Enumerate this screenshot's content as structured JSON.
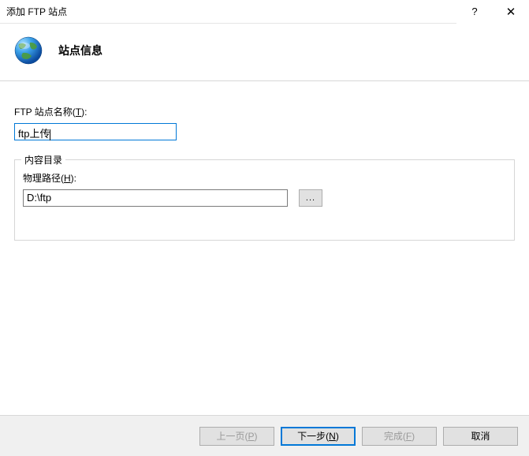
{
  "window": {
    "title": "添加 FTP 站点",
    "help": "?",
    "close": "✕"
  },
  "header": {
    "title": "站点信息"
  },
  "form": {
    "site_name": {
      "label_main": "FTP 站点名称(",
      "label_key": "T",
      "label_end": "):",
      "value": "ftp上传"
    },
    "content_dir": {
      "group_title": "内容目录",
      "path_label_main": "物理路径(",
      "path_label_key": "H",
      "path_label_end": "):",
      "path_value": "D:\\ftp",
      "browse_label": "..."
    }
  },
  "footer": {
    "prev_main": "上一页(",
    "prev_key": "P",
    "prev_end": ")",
    "next_main": "下一步(",
    "next_key": "N",
    "next_end": ")",
    "finish_main": "完成(",
    "finish_key": "F",
    "finish_end": ")",
    "cancel": "取消"
  }
}
